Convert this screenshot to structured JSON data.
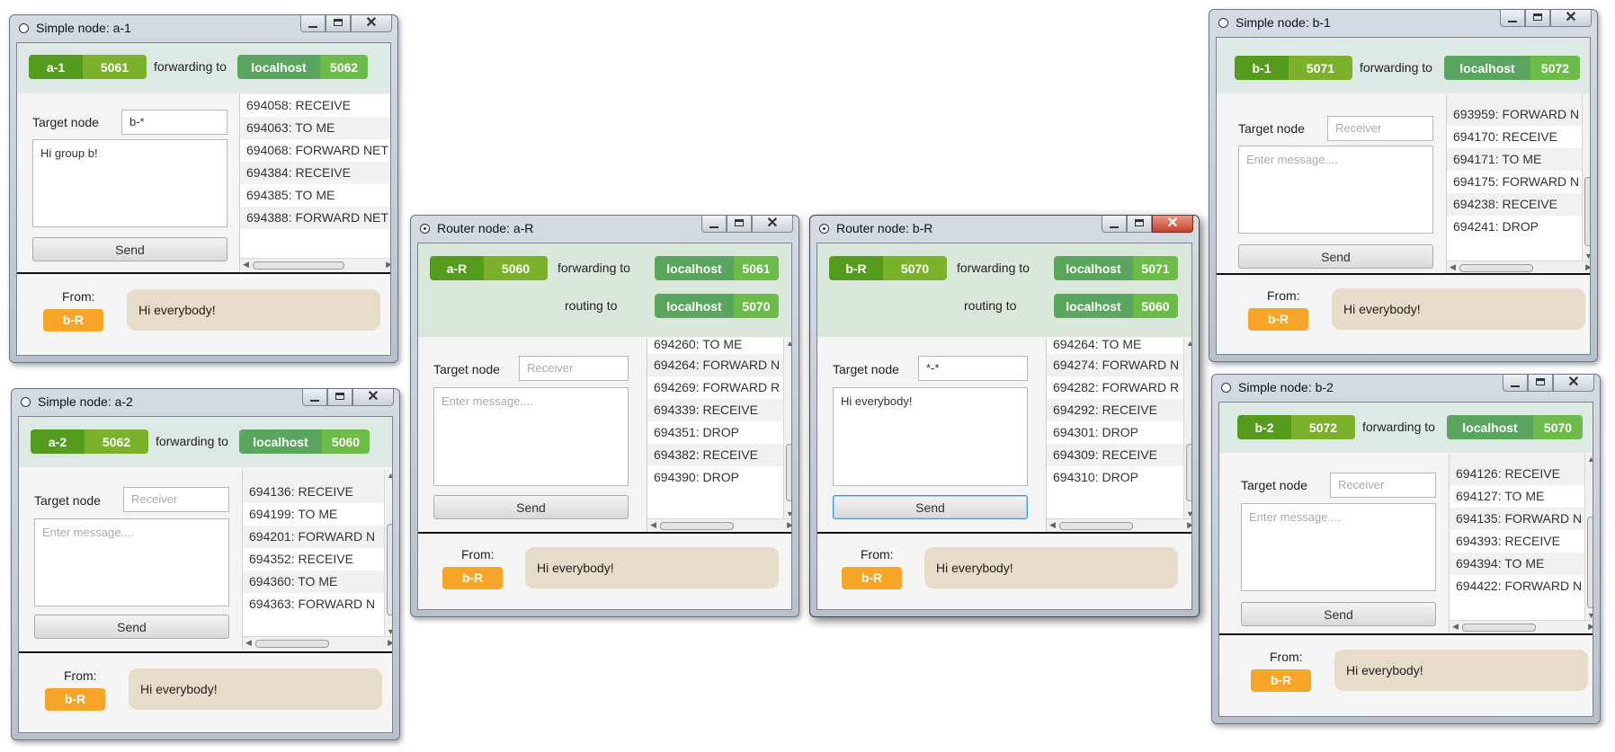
{
  "windows": [
    {
      "title": "Simple node: a-1",
      "own": {
        "name": "a-1",
        "port": "5061"
      },
      "forwarding_label": "forwarding to",
      "forward": {
        "host": "localhost",
        "port": "5062"
      },
      "target_label": "Target node",
      "target_value": "b-*",
      "target_placeholder": "",
      "message_value": "Hi group b!",
      "message_placeholder": "",
      "send_label": "Send",
      "log": [
        "694058: RECEIVE",
        "694063: TO ME",
        "694068: FORWARD NET",
        "694384: RECEIVE",
        "694385: TO ME",
        "694388: FORWARD NET"
      ],
      "from_label": "From:",
      "from_sender": "b-R",
      "from_message": "Hi everybody!"
    },
    {
      "title": "Simple node: a-2",
      "own": {
        "name": "a-2",
        "port": "5062"
      },
      "forwarding_label": "forwarding to",
      "forward": {
        "host": "localhost",
        "port": "5060"
      },
      "target_label": "Target node",
      "target_value": "",
      "target_placeholder": "Receiver",
      "message_value": "",
      "message_placeholder": "Enter message....",
      "send_label": "Send",
      "log": [
        "694136: RECEIVE",
        "694199: TO ME",
        "694201: FORWARD N",
        "694352: RECEIVE",
        "694360: TO ME",
        "694363: FORWARD N"
      ],
      "from_label": "From:",
      "from_sender": "b-R",
      "from_message": "Hi everybody!"
    },
    {
      "title": "Router node: a-R",
      "own": {
        "name": "a-R",
        "port": "5060"
      },
      "forwarding_label": "forwarding to",
      "forward": {
        "host": "localhost",
        "port": "5061"
      },
      "routing_label": "routing to",
      "route": {
        "host": "localhost",
        "port": "5070"
      },
      "target_label": "Target node",
      "target_value": "",
      "target_placeholder": "Receiver",
      "message_value": "",
      "message_placeholder": "Enter message....",
      "send_label": "Send",
      "log": [
        "694260: TO ME",
        "694264: FORWARD N",
        "694269: FORWARD R",
        "694339: RECEIVE",
        "694351: DROP",
        "694382: RECEIVE",
        "694390: DROP"
      ],
      "from_label": "From:",
      "from_sender": "b-R",
      "from_message": "Hi everybody!"
    },
    {
      "title": "Router node: b-R",
      "own": {
        "name": "b-R",
        "port": "5070"
      },
      "forwarding_label": "forwarding to",
      "forward": {
        "host": "localhost",
        "port": "5071"
      },
      "routing_label": "routing to",
      "route": {
        "host": "localhost",
        "port": "5060"
      },
      "target_label": "Target node",
      "target_value": "*-*",
      "target_placeholder": "",
      "message_value": "Hi everybody!",
      "message_placeholder": "",
      "send_label": "Send",
      "log": [
        "694264: TO ME",
        "694274: FORWARD N",
        "694282: FORWARD R",
        "694292: RECEIVE",
        "694301: DROP",
        "694309: RECEIVE",
        "694310: DROP"
      ],
      "from_label": "From:",
      "from_sender": "b-R",
      "from_message": "Hi everybody!"
    },
    {
      "title": "Simple node: b-1",
      "own": {
        "name": "b-1",
        "port": "5071"
      },
      "forwarding_label": "forwarding to",
      "forward": {
        "host": "localhost",
        "port": "5072"
      },
      "target_label": "Target node",
      "target_value": "",
      "target_placeholder": "Receiver",
      "message_value": "",
      "message_placeholder": "Enter message....",
      "send_label": "Send",
      "log": [
        "693959: FORWARD N",
        "694170: RECEIVE",
        "694171: TO ME",
        "694175: FORWARD N",
        "694238: RECEIVE",
        "694241: DROP"
      ],
      "from_label": "From:",
      "from_sender": "b-R",
      "from_message": "Hi everybody!"
    },
    {
      "title": "Simple node: b-2",
      "own": {
        "name": "b-2",
        "port": "5072"
      },
      "forwarding_label": "forwarding to",
      "forward": {
        "host": "localhost",
        "port": "5070"
      },
      "target_label": "Target node",
      "target_value": "",
      "target_placeholder": "Receiver",
      "message_value": "",
      "message_placeholder": "Enter message....",
      "send_label": "Send",
      "log": [
        "694126: RECEIVE",
        "694127: TO ME",
        "694135: FORWARD N",
        "694393: RECEIVE",
        "694394: TO ME",
        "694422: FORWARD N"
      ],
      "from_label": "From:",
      "from_sender": "b-R",
      "from_message": "Hi everybody!"
    }
  ]
}
